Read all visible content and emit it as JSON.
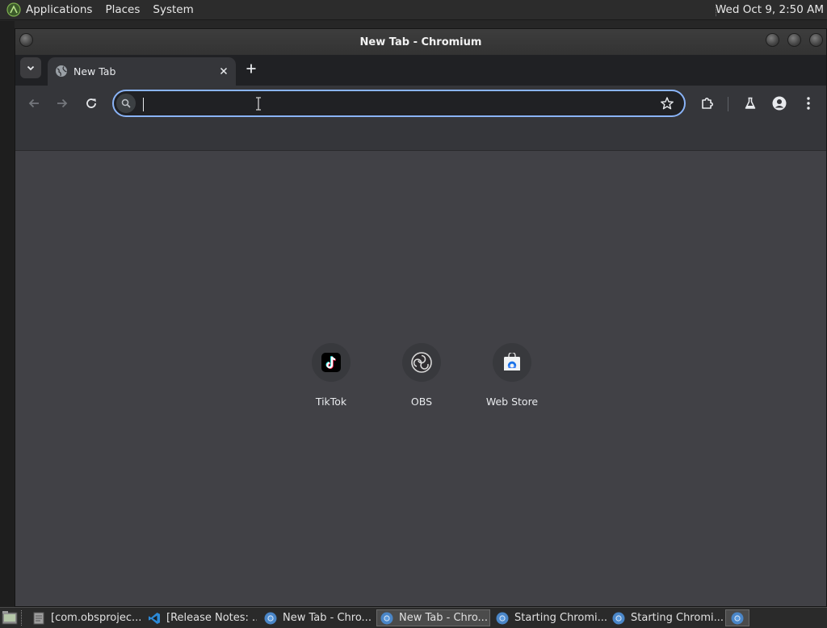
{
  "top_panel": {
    "menus": [
      "Applications",
      "Places",
      "System"
    ],
    "clock": "Wed Oct  9,  2:50 AM"
  },
  "window": {
    "title": "New Tab - Chromium"
  },
  "browser": {
    "tabs": [
      {
        "title": "New Tab",
        "icon": "globe-icon",
        "active": true
      }
    ],
    "omnibox": {
      "value": "",
      "placeholder": ""
    },
    "shortcuts": [
      {
        "label": "TikTok",
        "icon": "tiktok-icon"
      },
      {
        "label": "OBS",
        "icon": "obs-icon"
      },
      {
        "label": "Web Store",
        "icon": "web-store-icon"
      }
    ]
  },
  "taskbar": {
    "tasks": [
      {
        "label": "[com.obsprojec...",
        "icon": "text-editor-icon",
        "active": false
      },
      {
        "label": "[Release Notes: ...",
        "icon": "vscode-icon",
        "active": false
      },
      {
        "label": "New Tab - Chro...",
        "icon": "chromium-icon",
        "active": false
      },
      {
        "label": "New Tab - Chro...",
        "icon": "chromium-icon",
        "active": true
      },
      {
        "label": "Starting Chromi...",
        "icon": "chromium-icon",
        "active": false
      },
      {
        "label": "Starting Chromi...",
        "icon": "chromium-icon",
        "active": false
      }
    ]
  },
  "colors": {
    "focus_ring": "#8ab4f8",
    "content_bg": "#414146",
    "toolbar_bg": "#35363a",
    "tabstrip_bg": "#202124"
  }
}
